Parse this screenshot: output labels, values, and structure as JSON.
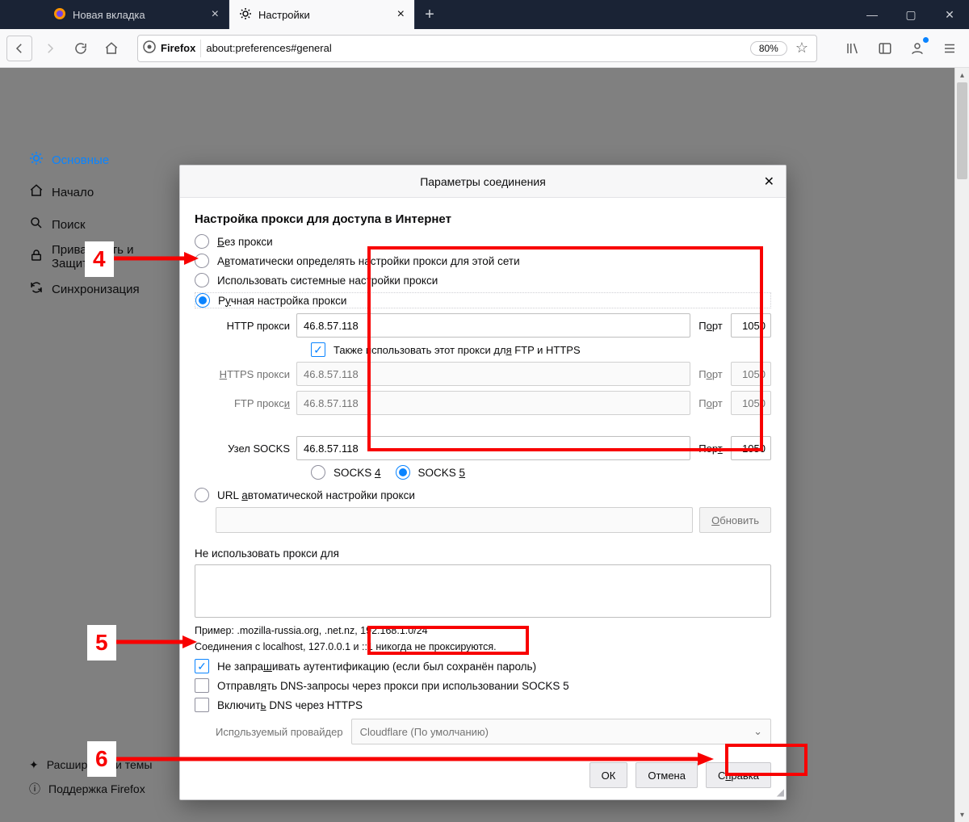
{
  "tabs": [
    {
      "label": "Новая вкладка",
      "active": false
    },
    {
      "label": "Настройки",
      "active": true
    }
  ],
  "url": {
    "browser_label": "Firefox",
    "address": "about:preferences#general",
    "zoom": "80%"
  },
  "sidebar": {
    "categories": [
      {
        "label": "Основные",
        "icon": "gear",
        "selected": true
      },
      {
        "label": "Начало",
        "icon": "home"
      },
      {
        "label": "Поиск",
        "icon": "search"
      },
      {
        "label": "Приватность и Защита",
        "icon": "lock"
      },
      {
        "label": "Синхронизация",
        "icon": "sync"
      }
    ],
    "footer": [
      {
        "label": "Расширения и темы",
        "icon": "puzzle"
      },
      {
        "label": "Поддержка Firefox",
        "icon": "help"
      }
    ]
  },
  "dialog": {
    "title": "Параметры соединения",
    "section": "Настройка прокси для доступа в Интернет",
    "options": {
      "none": "Без прокси",
      "auto_detect": "Автоматически определять настройки прокси для этой сети",
      "system": "Использовать системные настройки прокси",
      "manual": "Ручная настройка прокси",
      "pac": "URL автоматической настройки прокси"
    },
    "manual": {
      "http_label": "HTTP прокси",
      "http_host": "46.8.57.118",
      "http_port": "1050",
      "same_label": "Также использовать этот прокси для FTP и HTTPS",
      "https_label": "HTTPS прокси",
      "https_host": "46.8.57.118",
      "https_port": "1050",
      "ftp_label": "FTP прокси",
      "ftp_host": "46.8.57.118",
      "ftp_port": "1050",
      "socks_label": "Узел SOCKS",
      "socks_host": "46.8.57.118",
      "socks_port": "1050",
      "port_label": "Порт",
      "socks4": "SOCKS 4",
      "socks5": "SOCKS 5"
    },
    "pac_reload": "Обновить",
    "noproxy_label": "Не использовать прокси для",
    "hint_example": "Пример: .mozilla-russia.org, .net.nz, 192.168.1.0/24",
    "hint_localhost": "Соединения с localhost, 127.0.0.1 и ::1 никогда не проксируются.",
    "chk_noauth": "Не запрашивать аутентификацию (если был сохранён пароль)",
    "chk_socks_dns": "Отправлять DNS-запросы через прокси при использовании SOCKS 5",
    "chk_doh": "Включить DNS через HTTPS",
    "provider_label": "Используемый провайдер",
    "provider_value": "Cloudflare (По умолчанию)",
    "buttons": {
      "ok": "ОК",
      "cancel": "Отмена",
      "help": "Справка"
    }
  },
  "annotations": {
    "n4": "4",
    "n5": "5",
    "n6": "6"
  }
}
